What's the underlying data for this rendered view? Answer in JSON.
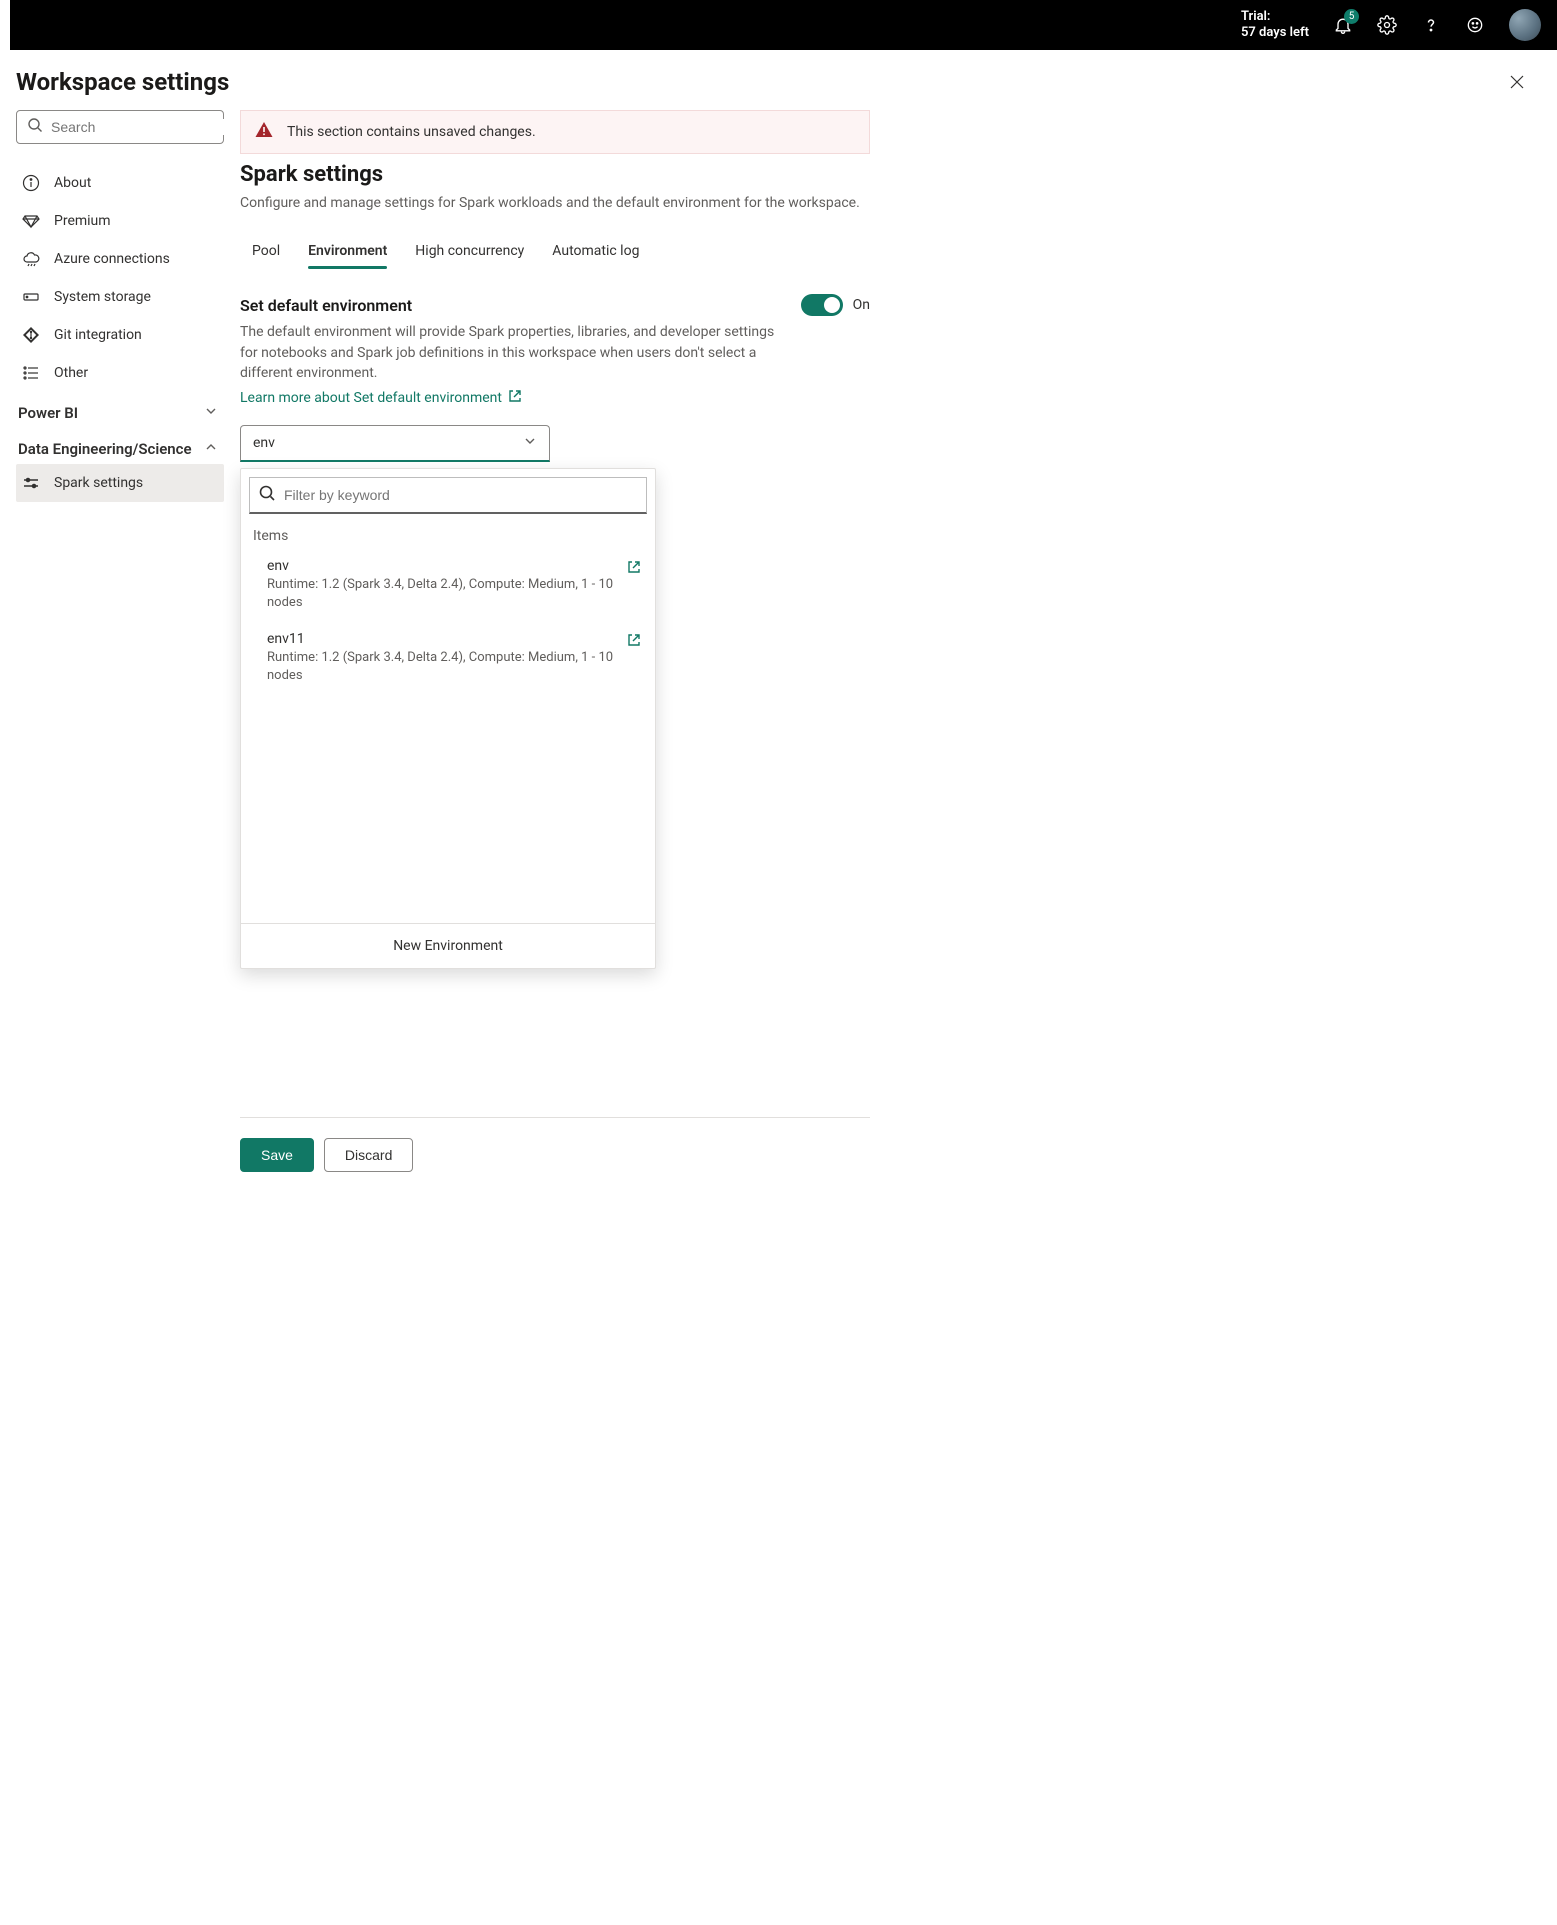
{
  "header": {
    "trial_label": "Trial:",
    "trial_days": "57 days left",
    "notif_badge": "5"
  },
  "page": {
    "title": "Workspace settings"
  },
  "sidebar": {
    "search_placeholder": "Search",
    "items": {
      "about": "About",
      "premium": "Premium",
      "azure": "Azure connections",
      "storage": "System storage",
      "git": "Git integration",
      "other": "Other"
    },
    "sections": {
      "powerbi": "Power BI",
      "des": "Data Engineering/Science"
    },
    "spark_settings": "Spark settings"
  },
  "main": {
    "alert_text": "This section contains unsaved changes.",
    "heading": "Spark settings",
    "subtitle": "Configure and manage settings for Spark workloads and the default environment for the workspace.",
    "tabs": {
      "pool": "Pool",
      "environment": "Environment",
      "high_concurrency": "High concurrency",
      "automatic_log": "Automatic log"
    },
    "section_title": "Set default environment",
    "toggle_label": "On",
    "section_desc": "The default environment will provide Spark properties, libraries, and developer settings for notebooks and Spark job definitions in this workspace when users don't select a different environment.",
    "learn_more": "Learn more about Set default environment",
    "combo_value": "env",
    "dropdown": {
      "filter_placeholder": "Filter by keyword",
      "items_label": "Items",
      "items": [
        {
          "name": "env",
          "detail": "Runtime: 1.2 (Spark 3.4, Delta 2.4), Compute: Medium, 1 - 10 nodes"
        },
        {
          "name": "env11",
          "detail": "Runtime: 1.2 (Spark 3.4, Delta 2.4), Compute: Medium, 1 - 10 nodes"
        }
      ],
      "new_env": "New Environment"
    },
    "buttons": {
      "save": "Save",
      "discard": "Discard"
    }
  }
}
